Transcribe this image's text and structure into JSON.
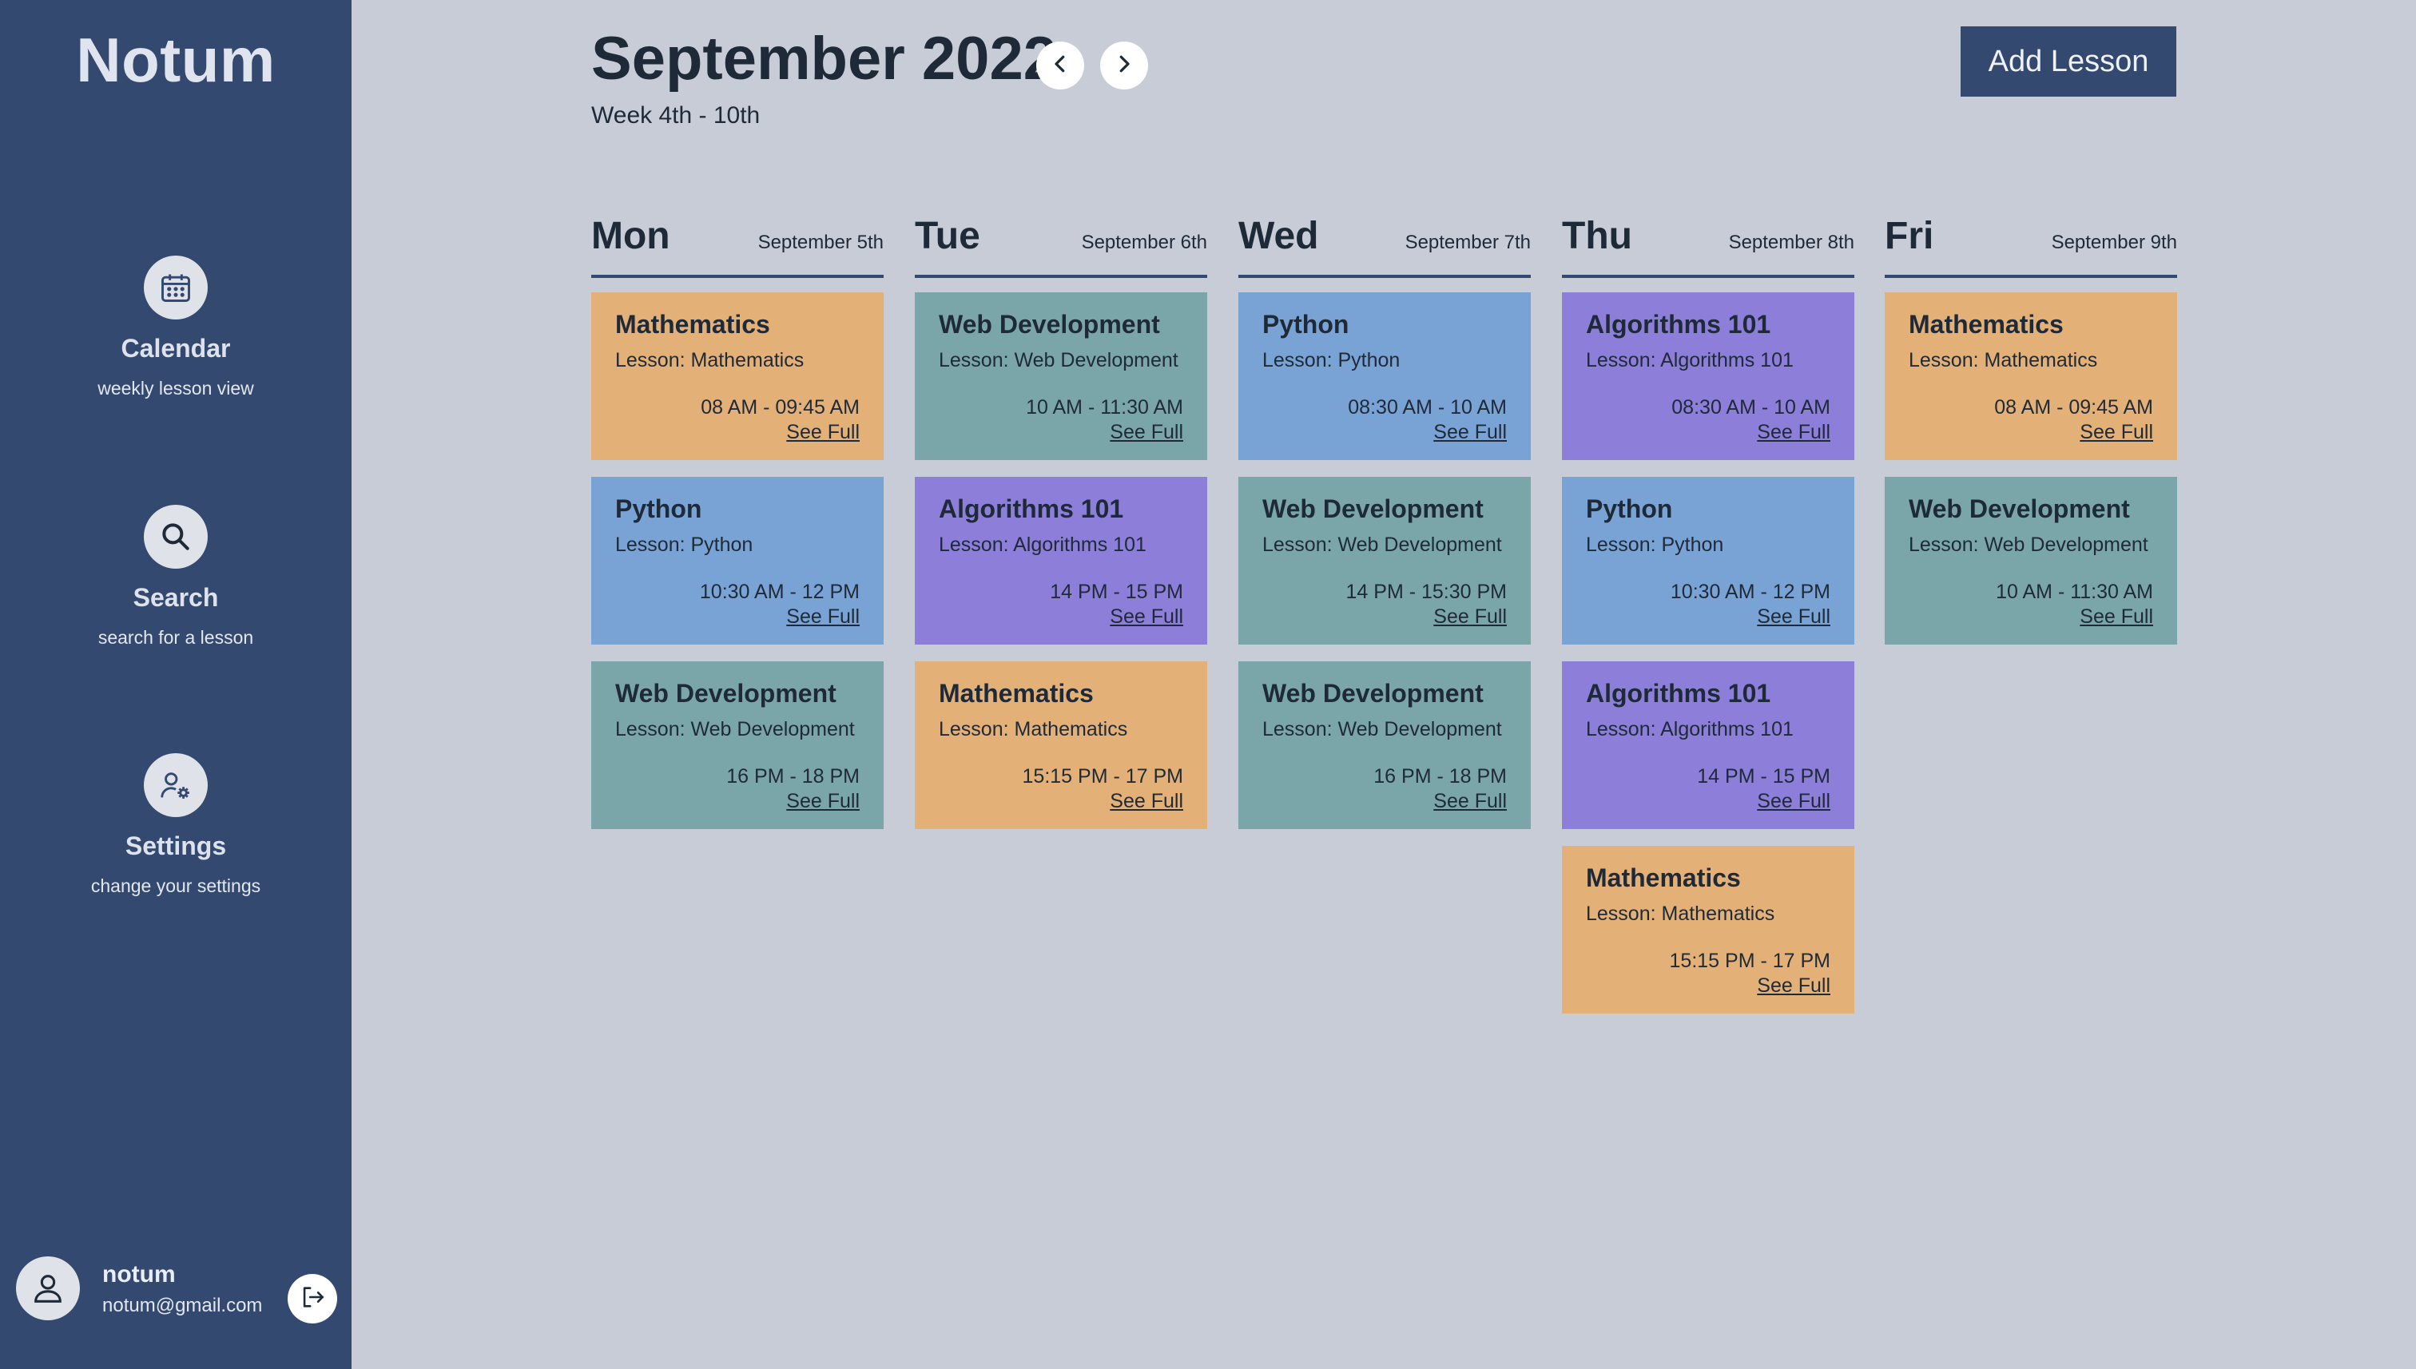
{
  "app": {
    "name": "Notum"
  },
  "sidebar": {
    "items": [
      {
        "label": "Calendar",
        "sub": "weekly lesson view",
        "icon": "calendar-icon"
      },
      {
        "label": "Search",
        "sub": "search for a lesson",
        "icon": "search-icon"
      },
      {
        "label": "Settings",
        "sub": "change your settings",
        "icon": "user-settings-icon"
      }
    ],
    "user": {
      "name": "notum",
      "email": "notum@gmail.com"
    }
  },
  "header": {
    "title": "September 2022",
    "week": "Week 4th - 10th",
    "add_label": "Add Lesson"
  },
  "colors": {
    "Mathematics": "#e3b077",
    "Web Development": "#7aa6aa",
    "Python": "#7aa3d5",
    "Algorithms 101": "#8c7ed9"
  },
  "days": [
    {
      "name": "Mon",
      "date": "September 5th",
      "lessons": [
        {
          "title": "Mathematics",
          "sub": "Lesson: Mathematics",
          "time": "08 AM - 09:45 AM",
          "link": "See Full"
        },
        {
          "title": "Python",
          "sub": "Lesson: Python",
          "time": "10:30 AM - 12 PM",
          "link": "See Full"
        },
        {
          "title": "Web Development",
          "sub": "Lesson: Web Development",
          "time": "16 PM - 18 PM",
          "link": "See Full"
        }
      ]
    },
    {
      "name": "Tue",
      "date": "September 6th",
      "lessons": [
        {
          "title": "Web Development",
          "sub": "Lesson: Web Development",
          "time": "10 AM - 11:30 AM",
          "link": "See Full"
        },
        {
          "title": "Algorithms 101",
          "sub": "Lesson: Algorithms 101",
          "time": "14 PM - 15 PM",
          "link": "See Full"
        },
        {
          "title": "Mathematics",
          "sub": "Lesson: Mathematics",
          "time": "15:15 PM - 17 PM",
          "link": "See Full"
        }
      ]
    },
    {
      "name": "Wed",
      "date": "September 7th",
      "lessons": [
        {
          "title": "Python",
          "sub": "Lesson: Python",
          "time": "08:30 AM - 10 AM",
          "link": "See Full"
        },
        {
          "title": "Web Development",
          "sub": "Lesson: Web Development",
          "time": "14 PM - 15:30 PM",
          "link": "See Full"
        },
        {
          "title": "Web Development",
          "sub": "Lesson: Web Development",
          "time": "16 PM - 18 PM",
          "link": "See Full"
        }
      ]
    },
    {
      "name": "Thu",
      "date": "September 8th",
      "lessons": [
        {
          "title": "Algorithms 101",
          "sub": "Lesson: Algorithms 101",
          "time": "08:30 AM - 10 AM",
          "link": "See Full"
        },
        {
          "title": "Python",
          "sub": "Lesson: Python",
          "time": "10:30 AM - 12 PM",
          "link": "See Full"
        },
        {
          "title": "Algorithms 101",
          "sub": "Lesson: Algorithms 101",
          "time": "14 PM - 15 PM",
          "link": "See Full"
        },
        {
          "title": "Mathematics",
          "sub": "Lesson: Mathematics",
          "time": "15:15 PM - 17 PM",
          "link": "See Full"
        }
      ]
    },
    {
      "name": "Fri",
      "date": "September 9th",
      "lessons": [
        {
          "title": "Mathematics",
          "sub": "Lesson: Mathematics",
          "time": "08 AM - 09:45 AM",
          "link": "See Full"
        },
        {
          "title": "Web Development",
          "sub": "Lesson: Web Development",
          "time": "10 AM - 11:30 AM",
          "link": "See Full"
        }
      ]
    }
  ]
}
